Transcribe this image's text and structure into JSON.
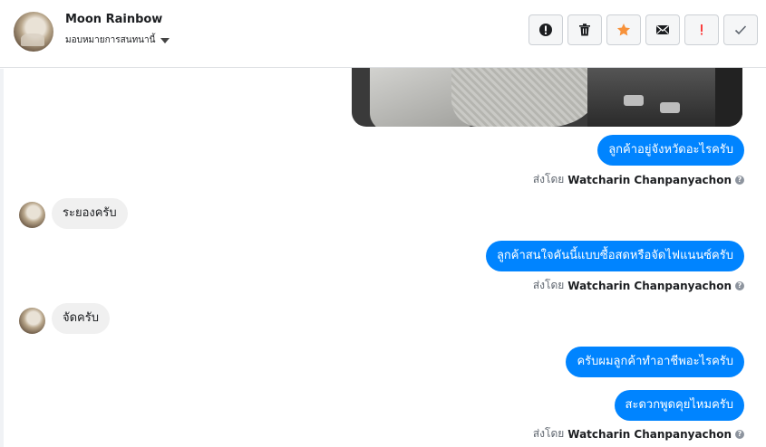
{
  "header": {
    "name": "Moon Rainbow",
    "assign_label": "มอบหมายการสนทนานี้"
  },
  "actions": [
    {
      "icon": "alert-circle-icon",
      "label": "Mark as spam"
    },
    {
      "icon": "trash-icon",
      "label": "Delete"
    },
    {
      "icon": "star-icon",
      "label": "Star",
      "color": "#f7923b"
    },
    {
      "icon": "envelope-icon",
      "label": "Mark as unread"
    },
    {
      "icon": "exclamation-icon",
      "label": "Follow up",
      "color": "#fa3e3e"
    },
    {
      "icon": "check-icon",
      "label": "Done"
    }
  ],
  "messages": {
    "out1": "ลูกค้าอยู่จังหวัดอะไรครับ",
    "in1": "ระยองครับ",
    "out2": "ลูกค้าสนใจคันนี้แบบซื้อสดหรือจัดไฟแนนซ์ครับ",
    "in2": "จัดครับ",
    "out3": "ครับผมลูกค้าทำอาชีพอะไรครับ",
    "out4": "สะดวกพูดคุยไหมครับ"
  },
  "sent_by": {
    "prefix": "ส่งโดย",
    "name": "Watcharin Chanpanyachon",
    "help": "?"
  },
  "colors": {
    "accent": "#0084ff",
    "incoming_bubble": "#f0f0f0"
  }
}
